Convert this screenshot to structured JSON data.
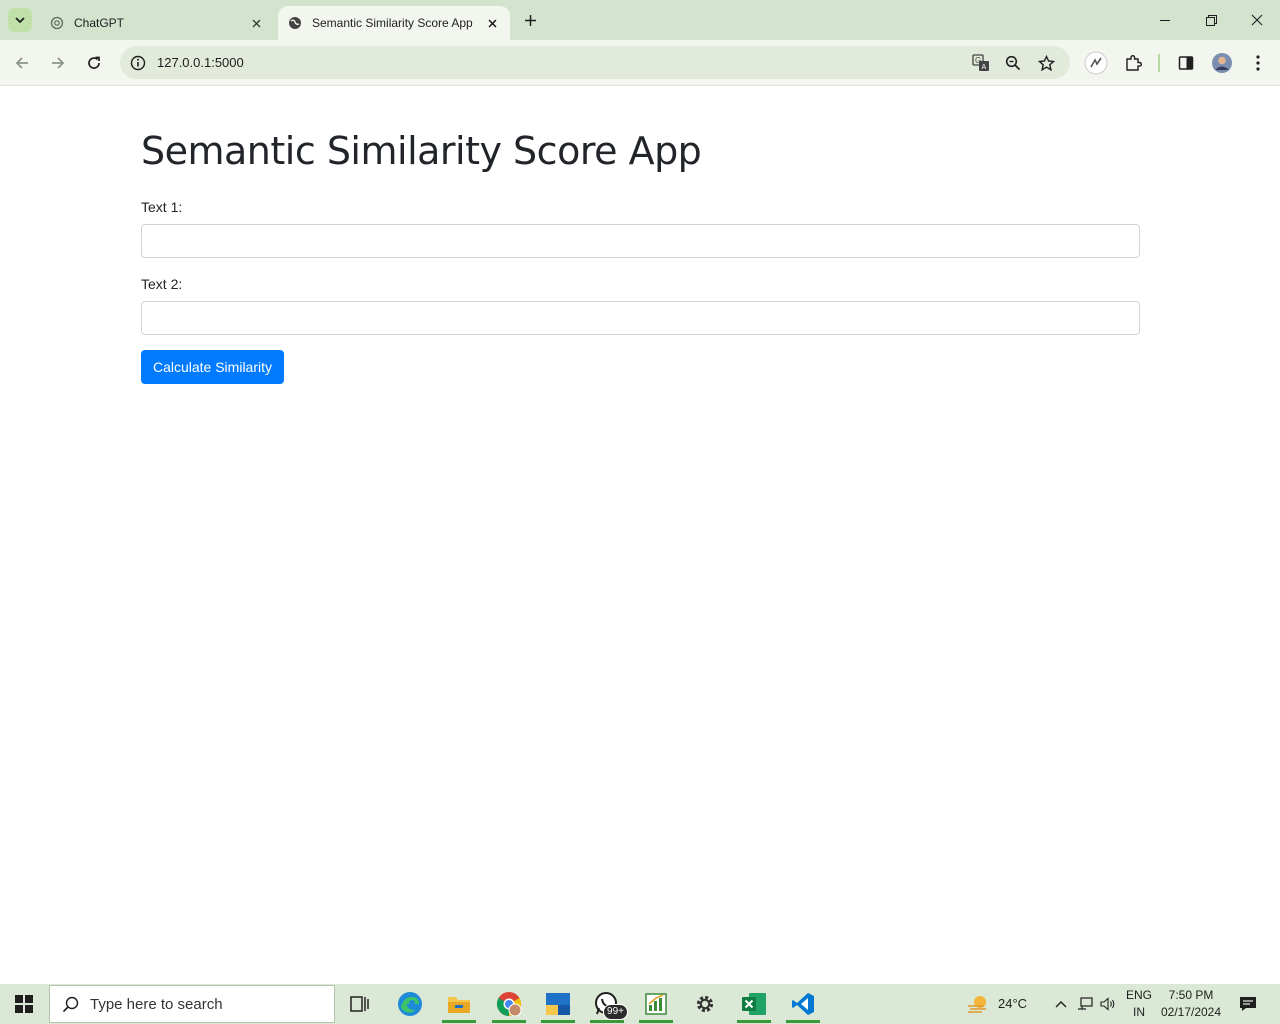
{
  "browser": {
    "tabs": [
      {
        "title": "ChatGPT"
      },
      {
        "title": "Semantic Similarity Score App"
      }
    ],
    "address": "127.0.0.1:5000"
  },
  "page": {
    "title": "Semantic Similarity Score App",
    "text1_label": "Text 1:",
    "text1_value": "",
    "text2_label": "Text 2:",
    "text2_value": "",
    "button_label": "Calculate Similarity"
  },
  "taskbar": {
    "search_placeholder": "Type here to search",
    "whatsapp_badge": "99+",
    "weather": "24°C",
    "language_line1": "ENG",
    "language_line2": "IN",
    "time": "7:50 PM",
    "date": "02/17/2024"
  },
  "colors": {
    "accent": "#007bff",
    "chrome_tabbar": "#d3e3cd",
    "chrome_toolbar": "#f2f6ef"
  }
}
